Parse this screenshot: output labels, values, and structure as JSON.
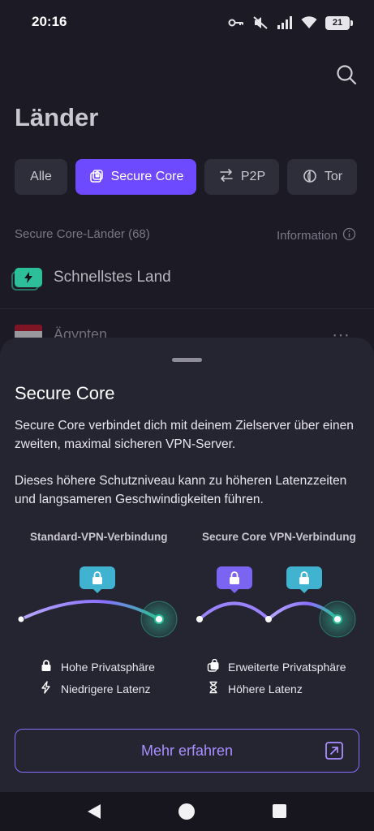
{
  "status_bar": {
    "time": "20:16",
    "battery": "21",
    "icons": [
      "key-icon",
      "mute-icon",
      "signal-icon",
      "wifi-icon",
      "battery-icon"
    ]
  },
  "screen": {
    "title": "Länder",
    "filters": [
      {
        "label": "Alle",
        "active": false
      },
      {
        "label": "Secure Core",
        "active": true,
        "icon": "secure-core-icon"
      },
      {
        "label": "P2P",
        "active": false,
        "icon": "swap-arrows-icon"
      },
      {
        "label": "Tor",
        "active": false,
        "icon": "onion-icon"
      }
    ],
    "list_header": "Secure Core-Länder (68)",
    "info_label": "Information",
    "fastest_label": "Schnellstes Land",
    "country": "Ägypten"
  },
  "sheet": {
    "title": "Secure Core",
    "paragraph1": "Secure Core verbindet dich mit deinem Zielserver über einen zweiten, maximal sicheren VPN-Server.",
    "paragraph2": "Dieses höhere Schutzniveau kann zu höheren Latenzzeiten und langsameren Geschwindigkeiten führen.",
    "standard_label": "Standard-VPN-Verbindung",
    "secure_label": "Secure Core VPN-Verbindung",
    "legend": {
      "privacy_high": "Hohe Privatsphäre",
      "latency_lower": "Niedrigere Latenz",
      "privacy_extended": "Erweiterte Privatsphäre",
      "latency_higher": "Höhere Latenz"
    },
    "button": "Mehr erfahren"
  },
  "colors": {
    "accent": "#6d4aff",
    "teal": "#2dbf9a",
    "background": "#1b1a25",
    "sheet": "#252431"
  }
}
